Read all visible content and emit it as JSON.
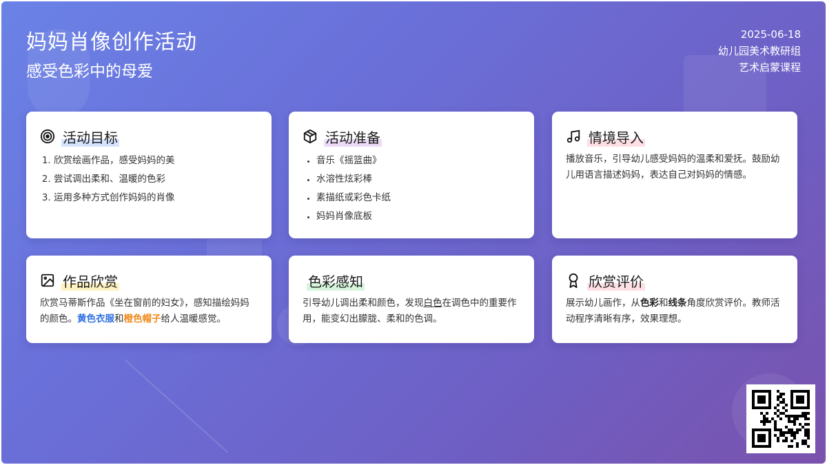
{
  "header": {
    "title": "妈妈肖像创作活动",
    "subtitle": "感受色彩中的母爱",
    "date": "2025-06-18",
    "org": "幼儿园美术教研组",
    "course": "艺术启蒙课程"
  },
  "cards": {
    "goals": {
      "title": "活动目标",
      "icon": "target-icon",
      "items": [
        "欣赏绘画作品，感受妈妈的美",
        "尝试调出柔和、温暖的色彩",
        "运用多种方式创作妈妈的肖像"
      ]
    },
    "prep": {
      "title": "活动准备",
      "icon": "box-icon",
      "items": [
        "音乐《摇篮曲》",
        "水溶性炫彩棒",
        "素描纸或彩色卡纸",
        "妈妈肖像底板"
      ]
    },
    "intro": {
      "title": "情境导入",
      "icon": "music-icon",
      "text": "播放音乐，引导幼儿感受妈妈的温柔和爱抚。鼓励幼儿用语言描述妈妈，表达自己对妈妈的情感。"
    },
    "appreciate": {
      "title": "作品欣赏",
      "icon": "image-icon",
      "text_a": "欣赏马蒂斯作品《坐在窗前的妇女》，感知描绘妈妈的颜色。",
      "em1": "黄色衣服",
      "mid": "和",
      "em2": "橙色帽子",
      "text_b": "给人温暖感觉。"
    },
    "color": {
      "title": "色彩感知",
      "text_a": "引导幼儿调出柔和颜色，发现",
      "em": "白色",
      "text_b": "在调色中的重要作用，能变幻出朦胧、柔和的色调。"
    },
    "eval": {
      "title": "欣赏评价",
      "icon": "award-icon",
      "text_a": "展示幼儿画作，从",
      "em1": "色彩",
      "mid": "和",
      "em2": "线条",
      "text_b": "角度欣赏评价。教师活动程序清晰有序，效果理想。"
    }
  },
  "colors": {
    "accent_blue": "#2f6fe0",
    "accent_orange": "#f08a1c"
  }
}
